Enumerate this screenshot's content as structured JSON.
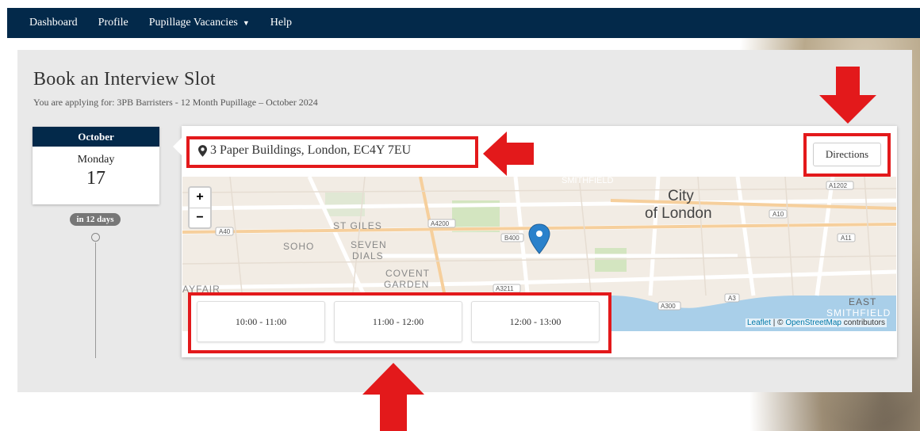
{
  "nav": {
    "items": [
      {
        "label": "Dashboard"
      },
      {
        "label": "Profile"
      },
      {
        "label": "Pupillage Vacancies",
        "dropdown": true
      },
      {
        "label": "Help"
      }
    ]
  },
  "page": {
    "title": "Book an Interview Slot",
    "subtitle": "You are applying for: 3PB Barristers - 12 Month Pupillage – October 2024"
  },
  "date_card": {
    "month": "October",
    "weekday": "Monday",
    "day": "17",
    "badge": "in 12 days"
  },
  "location": {
    "address": "3 Paper Buildings, London, EC4Y 7EU",
    "directions_label": "Directions"
  },
  "map": {
    "zoom_in": "+",
    "zoom_out": "−",
    "labels": {
      "city1": "City",
      "city2": "of London",
      "smithfield_top": "SMITHFIELD",
      "st_giles": "ST GILES",
      "seven": "SEVEN",
      "dials": "DIALS",
      "soho": "SOHO",
      "covent": "COVENT",
      "garden": "GARDEN",
      "mayfair": "AYFAIR",
      "east": "EAST",
      "smithfield_bottom": "SMITHFIELD"
    },
    "roads": [
      "A40",
      "A4200",
      "B400",
      "A10",
      "A1202",
      "A11",
      "A3211",
      "A300",
      "A3"
    ],
    "attribution": {
      "leaflet": "Leaflet",
      "separator": " | © ",
      "osm": "OpenStreetMap",
      "suffix": " contributors"
    }
  },
  "slots": [
    {
      "label": "10:00 - 11:00"
    },
    {
      "label": "11:00 - 12:00"
    },
    {
      "label": "12:00 - 13:00"
    }
  ],
  "colors": {
    "navbar": "#03294a",
    "highlight": "#e3191b",
    "map_water": "#a9cfe9",
    "marker": "#2a81cb"
  }
}
